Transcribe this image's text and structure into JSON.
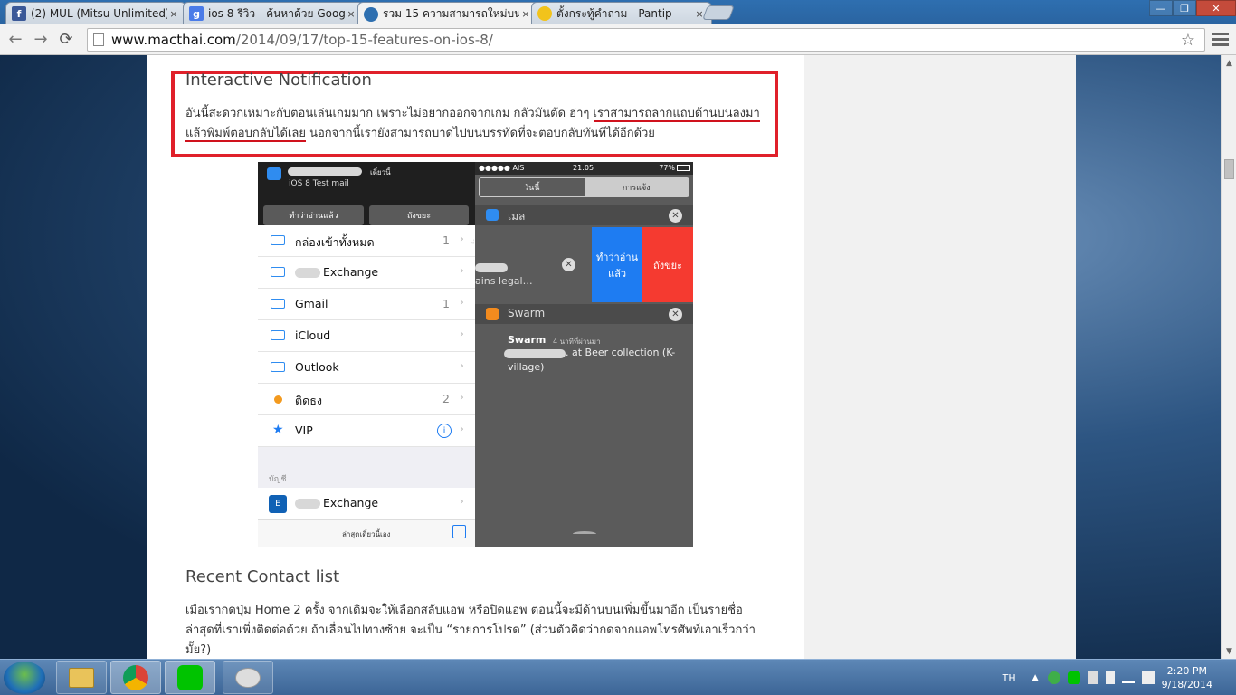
{
  "browser": {
    "tabs": [
      {
        "title": "(2) MUL (Mitsu Unlimited)",
        "favicon": "facebook-icon"
      },
      {
        "title": "ios 8 รีวิว - ค้นหาด้วย Googl",
        "favicon": "google-icon"
      },
      {
        "title": "รวม 15 ความสามารถใหม่บน",
        "favicon": "apple-icon"
      },
      {
        "title": "ตั้งกระทู้คำถาม - Pantip",
        "favicon": "pantip-icon"
      }
    ],
    "close_glyph": "×",
    "url_host": "www.macthai.com",
    "url_path": "/2014/09/17/top-15-features-on-ios-8/"
  },
  "article": {
    "section1_heading": "Interactive Notification",
    "section1_line1_a": "อันนี้สะดวกเหมาะกับตอนเล่นเกมมาก เพราะไม่อยากออกจากเกม กลัวมันตัด ฮ่าๆ ",
    "section1_line1_b": "เราสามารถลากแถบด้านบนลงมา",
    "section1_line2_a": "แล้วพิมพ์ตอบกลับได้เลย",
    "section1_line2_b": " นอกจากนี้เรายังสามารถบาดไปบนบรรทัดที่จะตอบกลับทันทีได้อีกด้วย",
    "section2_heading": "Recent Contact list",
    "section2_line1": "เมื่อเรากดปุ่ม Home 2 ครั้ง จากเดิมจะให้เลือกสลับแอพ หรือปิดแอพ ตอนนี้จะมีด้านบนเพิ่มขึ้นมาอีก เป็นรายชื่อ",
    "section2_line2": "ล่าสุดที่เราเพิ่งติดต่อด้วย ถ้าเลื่อนไปทางซ้าย จะเป็น “รายการโปรด” (ส่วนตัวคิดว่ากดจากแอพโทรศัพท์เอาเร็วกว่า",
    "section2_line3": "มั้ย?)"
  },
  "ios_left": {
    "banner_time": "เดี๋ยวนี้",
    "banner_subject": "iOS 8 Test mail",
    "btn_read": "ทำว่าอ่านแล้ว",
    "btn_trash": "ถังขยะ",
    "mailboxes": [
      {
        "label": "กล่องเข้าทั้งหมด",
        "count": "1"
      },
      {
        "label": "Exchange",
        "count": ""
      },
      {
        "label": "Gmail",
        "count": "1"
      },
      {
        "label": "iCloud",
        "count": ""
      },
      {
        "label": "Outlook",
        "count": ""
      },
      {
        "label": "ติดธง",
        "count": "2"
      },
      {
        "label": "VIP",
        "count": ""
      }
    ],
    "accounts_header": "บัญชี",
    "account_exchange": "Exchange",
    "footer_updated": "ล่าสุดเดี๋ยวนี้เอง",
    "chevron": "›",
    "info_glyph": "i"
  },
  "ios_right": {
    "carrier": "●●●●● AIS",
    "time": "21:05",
    "battery": "77%",
    "seg_today": "วันนี้",
    "seg_notifications": "การแจ้ง",
    "mail_section": "เมล",
    "mail_preview": "ains legal…",
    "mail_prefix": "ี่",
    "swipe_read": "ทำว่าอ่าน แล้ว",
    "swipe_trash": "ถังขยะ",
    "swarm_section": "Swarm",
    "swarm_title": "Swarm",
    "swarm_time": "4 นาทีที่ผ่านมา",
    "swarm_body_a": ". at Beer collection (K-",
    "swarm_body_b": "village)",
    "close_glyph": "✕"
  },
  "taskbar": {
    "lang": "TH",
    "time": "2:20 PM",
    "date": "9/18/2014",
    "apps": [
      "file-explorer-icon",
      "chrome-icon",
      "line-icon",
      "paint-icon"
    ]
  },
  "colors": {
    "highlight_red": "#e0202a",
    "ios_blue": "#1e7cf2",
    "ios_red": "#f53a30"
  }
}
